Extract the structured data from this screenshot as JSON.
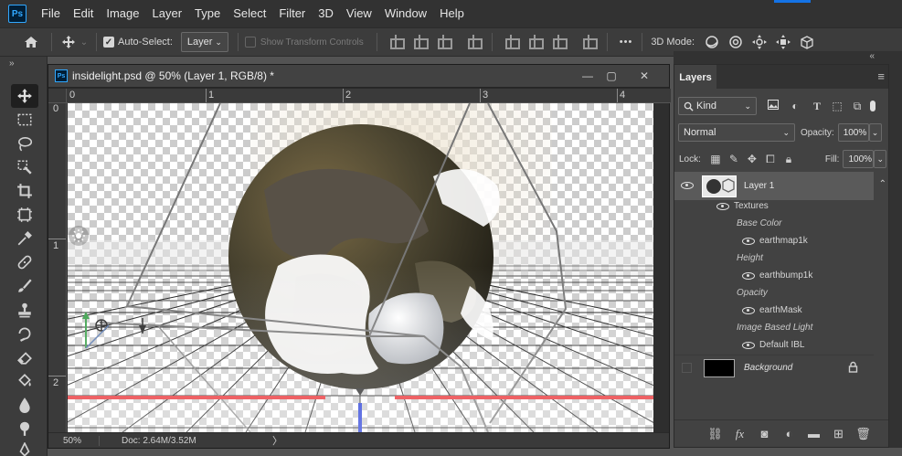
{
  "menubar": {
    "logo": "Ps",
    "items": [
      "File",
      "Edit",
      "Image",
      "Layer",
      "Type",
      "Select",
      "Filter",
      "3D",
      "View",
      "Window",
      "Help"
    ]
  },
  "options": {
    "auto_select_label": "Auto-Select:",
    "auto_select_checked": true,
    "auto_select_target": "Layer",
    "show_transform_label": "Show Transform Controls",
    "show_transform_checked": false,
    "more": "•••",
    "mode_label": "3D Mode:"
  },
  "toolbar": {
    "collapse": "»",
    "tools": [
      "move-tool",
      "marquee-tool",
      "lasso-tool",
      "quick-select-tool",
      "crop-tool",
      "frame-tool",
      "eyedropper-tool",
      "healing-brush-tool",
      "brush-tool",
      "clone-stamp-tool",
      "history-brush-tool",
      "eraser-tool",
      "paint-bucket-tool",
      "blur-tool",
      "dodge-tool",
      "pen-tool"
    ]
  },
  "document": {
    "icon": "Ps",
    "title": "insidelight.psd @ 50% (Layer 1, RGB/8) *",
    "ruler_h": [
      "0",
      "1",
      "2",
      "3",
      "4"
    ],
    "ruler_v": [
      "0",
      "1",
      "2"
    ],
    "zoom": "50%",
    "doc_size": "Doc: 2.64M/3.52M",
    "status_arrow": "〉"
  },
  "layers": {
    "collapse": "«",
    "tab": "Layers",
    "filter": "Kind",
    "blend_mode": "Normal",
    "opacity_label": "Opacity:",
    "opacity": "100%",
    "lock_label": "Lock:",
    "fill_label": "Fill:",
    "fill": "100%",
    "layer1": {
      "name": "Layer 1"
    },
    "sub": [
      {
        "text": "Textures",
        "style": "plain",
        "eye": true
      },
      {
        "text": "Base Color",
        "style": "italic",
        "eye": false
      },
      {
        "text": "earthmap1k",
        "style": "plain",
        "eye": true
      },
      {
        "text": "Height",
        "style": "italic",
        "eye": false
      },
      {
        "text": "earthbump1k",
        "style": "plain",
        "eye": true
      },
      {
        "text": "Opacity",
        "style": "italic",
        "eye": false
      },
      {
        "text": "earthMask",
        "style": "plain",
        "eye": true
      },
      {
        "text": "Image Based Light",
        "style": "italic",
        "eye": false
      },
      {
        "text": "Default IBL",
        "style": "plain",
        "eye": true
      }
    ],
    "background": {
      "name": "Background"
    }
  }
}
